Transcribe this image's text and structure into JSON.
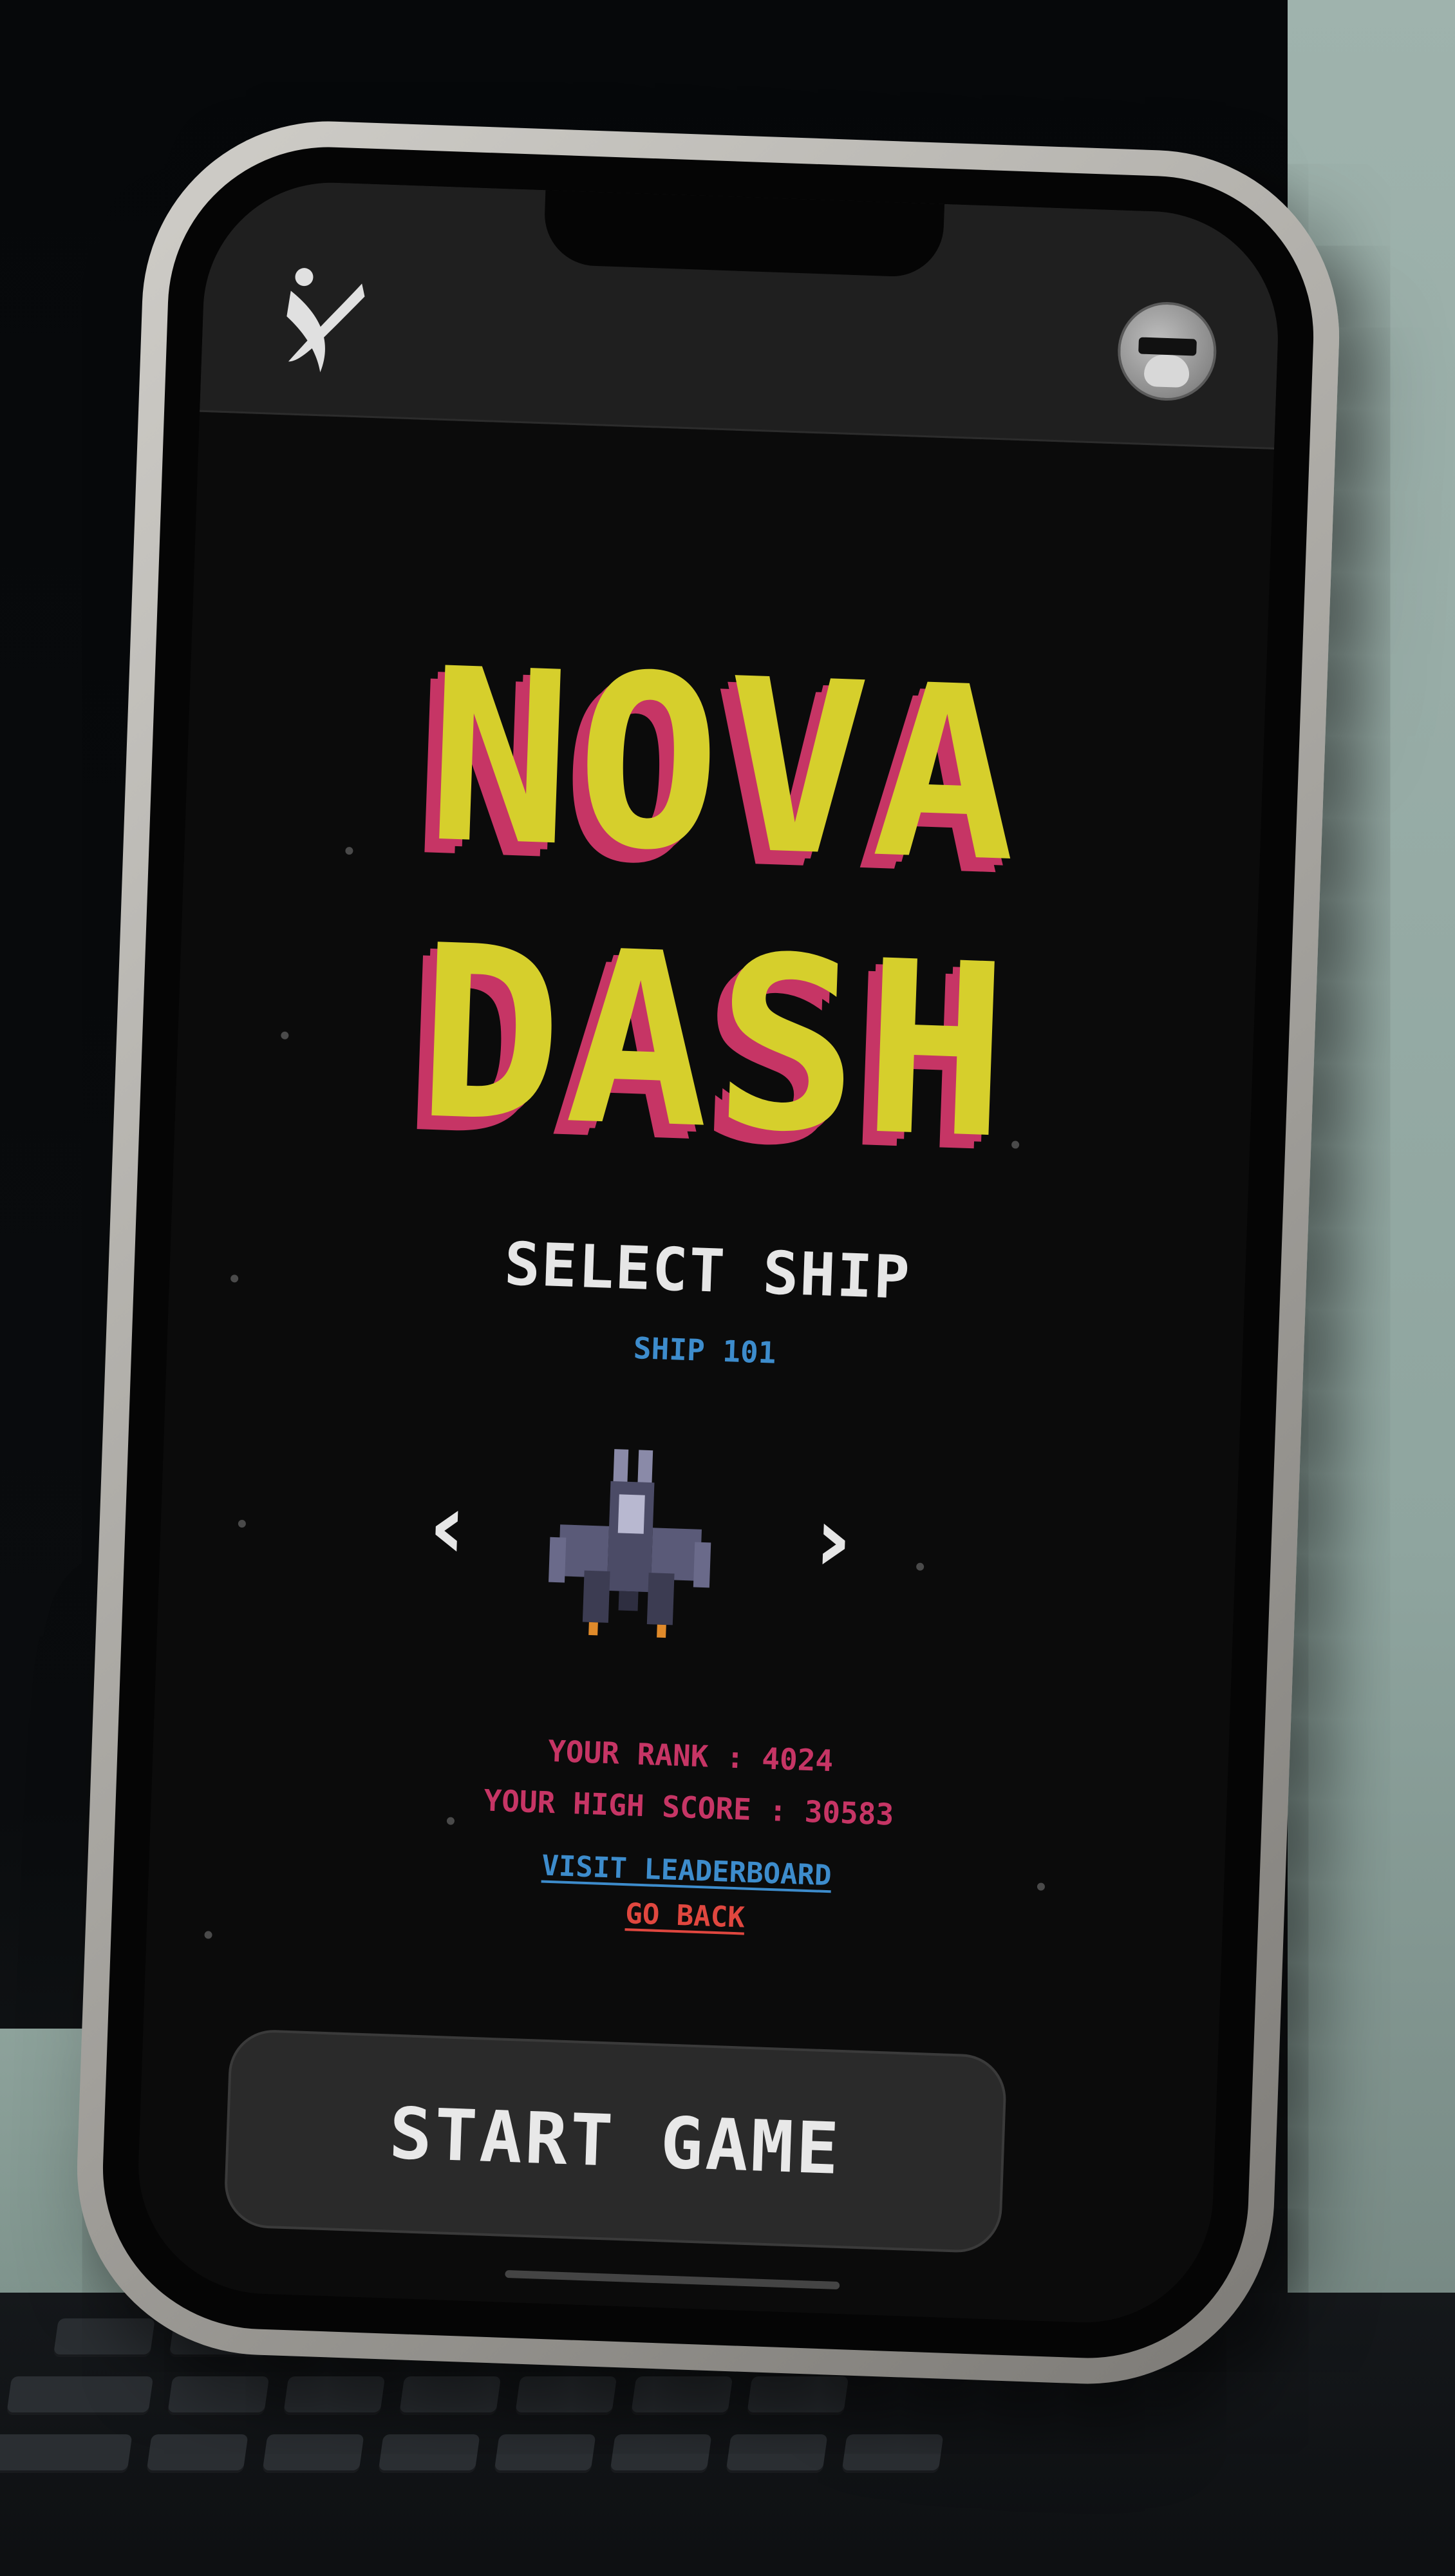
{
  "app": {
    "logo_icon": "stylized-x-logo-icon",
    "avatar_icon": "user-avatar-sunglasses-icon"
  },
  "game": {
    "title_line1": "NOVA",
    "title_line2": "DASH",
    "select_label": "SELECT SHIP",
    "ship_name": "SHIP 101",
    "prev_arrow": "‹",
    "next_arrow": "›",
    "rank_text": "YOUR RANK : 4024",
    "high_score_text": "YOUR HIGH SCORE : 30583",
    "leaderboard_link": "VISIT LEADERBOARD",
    "back_link": "GO BACK",
    "start_button": "START GAME"
  },
  "colors": {
    "title_yellow": "#d6cf2c",
    "title_shadow_pink": "#c63565",
    "accent_blue": "#3d8ccc",
    "stat_pink": "#c63565",
    "back_red": "#e0473f",
    "screen_bg": "#0b0b0b",
    "button_bg": "#2a2a2a"
  }
}
